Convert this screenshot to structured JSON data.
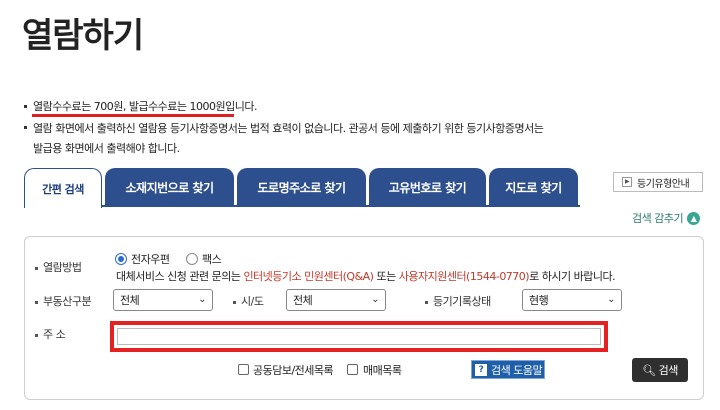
{
  "page_title": "열람하기",
  "notices": {
    "line1": "열람수수료는 700원, 발급수수료는 1000원입니다.",
    "line2": "열람 화면에서 출력하신 열람용 등기사항증명서는 법적 효력이 없습니다. 관공서 등에 제출하기 위한 등기사항증명서는",
    "line3": "발급용 화면에서 출력해야 합니다."
  },
  "tabs": [
    {
      "label": "간편 검색",
      "active": true
    },
    {
      "label": "소재지번으로 찾기",
      "active": false
    },
    {
      "label": "도로명주소로 찾기",
      "active": false
    },
    {
      "label": "고유번호로 찾기",
      "active": false
    },
    {
      "label": "지도로 찾기",
      "active": false
    }
  ],
  "guide_button": "등기유형안내",
  "collapse_label": "검색 감추기",
  "form": {
    "method": {
      "label": "열람방법",
      "option_email": "전자우편",
      "option_fax": "팩스",
      "selected": "전자우편",
      "note_pre": "대체서비스 신청 관련 문의는 ",
      "note_center1": "인터넷등기소 민원센터(Q&A)",
      "note_mid": " 또는 ",
      "note_center2": "사용자지원센터(1544-0770)",
      "note_post": "로 하시기 바랍니다."
    },
    "property_type": {
      "label": "부동산구분",
      "value": "전체"
    },
    "region": {
      "label": "시/도",
      "value": "전체"
    },
    "status": {
      "label": "등기기록상태",
      "value": "현행"
    },
    "address": {
      "label": "주 소",
      "value": ""
    },
    "checkbox_joint": "공동담보/전세목록",
    "checkbox_sale": "매매목록",
    "help_button": "검색 도움말",
    "search_button": "검색"
  },
  "colors": {
    "accent": "#2d4f8e",
    "highlight": "#e52222",
    "note_red": "#c0392b"
  }
}
